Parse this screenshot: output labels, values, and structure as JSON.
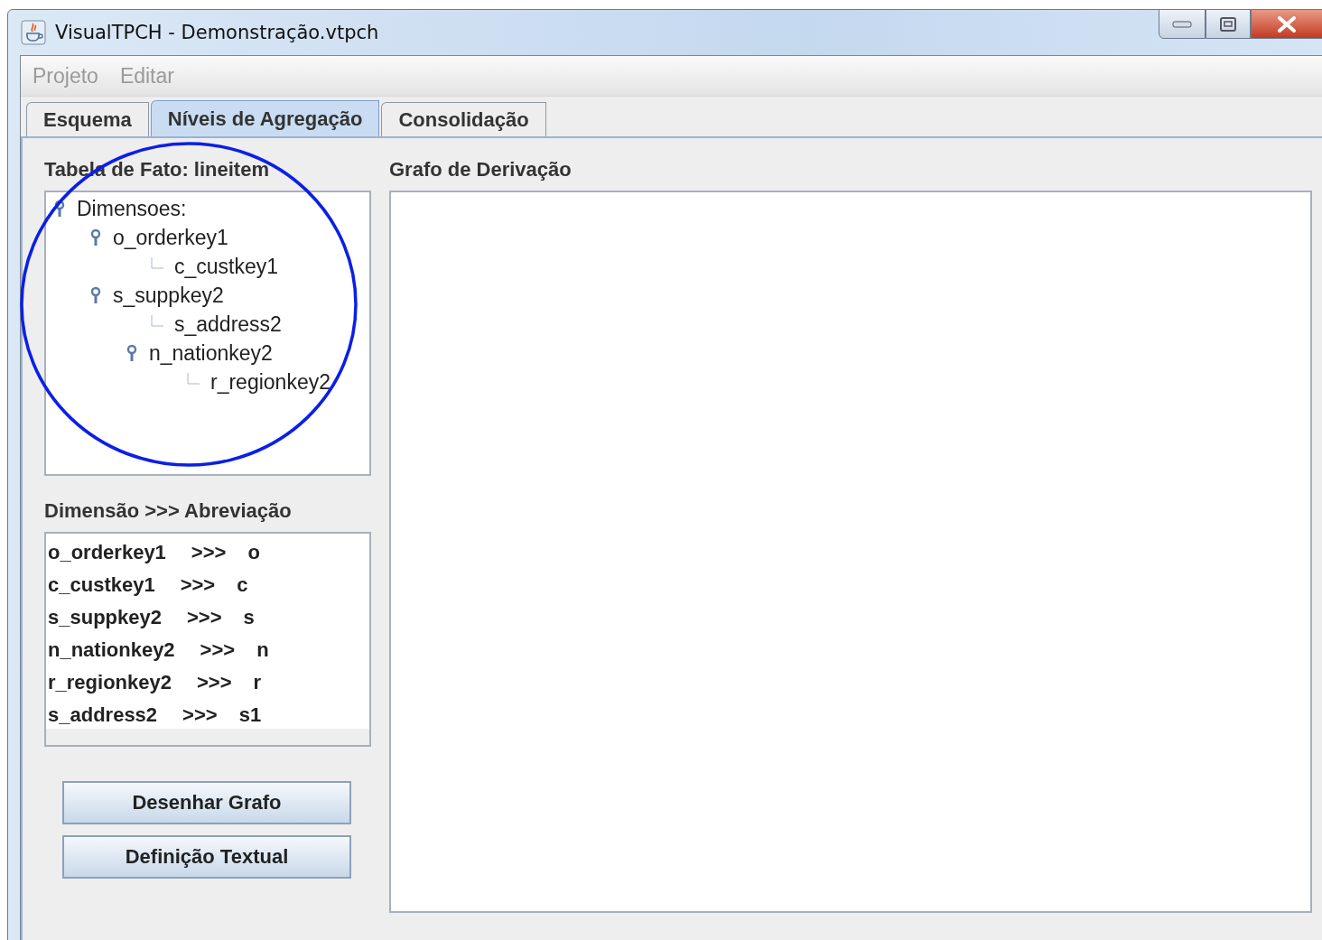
{
  "window": {
    "title": "VisualTPCH - Demonstração.vtpch"
  },
  "menu": [
    {
      "label": "Projeto",
      "disabled": true
    },
    {
      "label": "Editar",
      "disabled": true
    }
  ],
  "tabs": [
    {
      "label": "Esquema",
      "selected": false
    },
    {
      "label": "Níveis de Agregação",
      "selected": true
    },
    {
      "label": "Consolidação",
      "selected": false
    }
  ],
  "fact_table": {
    "label": "Tabela de Fato: lineitem",
    "tree": [
      {
        "label": "Dimensoes:",
        "children": [
          {
            "label": "o_orderkey1",
            "children": [
              {
                "label": "c_custkey1"
              }
            ]
          },
          {
            "label": "s_suppkey2",
            "children": [
              {
                "label": "s_address2"
              },
              {
                "label": "n_nationkey2",
                "children": [
                  {
                    "label": "r_regionkey2"
                  }
                ]
              }
            ]
          }
        ]
      }
    ]
  },
  "abbreviations": {
    "label": "Dimensão >>> Abreviação",
    "rows": [
      {
        "dimension": "o_orderkey1",
        "separator": ">>>",
        "abbreviation": "o"
      },
      {
        "dimension": "c_custkey1",
        "separator": ">>>",
        "abbreviation": "c"
      },
      {
        "dimension": "s_suppkey2",
        "separator": ">>>",
        "abbreviation": "s"
      },
      {
        "dimension": "n_nationkey2",
        "separator": ">>>",
        "abbreviation": "n"
      },
      {
        "dimension": "r_regionkey2",
        "separator": ">>>",
        "abbreviation": "r"
      },
      {
        "dimension": "s_address2",
        "separator": ">>>",
        "abbreviation": "s1"
      }
    ]
  },
  "buttons": [
    "Desenhar Grafo",
    "Definição Textual"
  ],
  "graph": {
    "label": "Grafo de Derivação"
  }
}
